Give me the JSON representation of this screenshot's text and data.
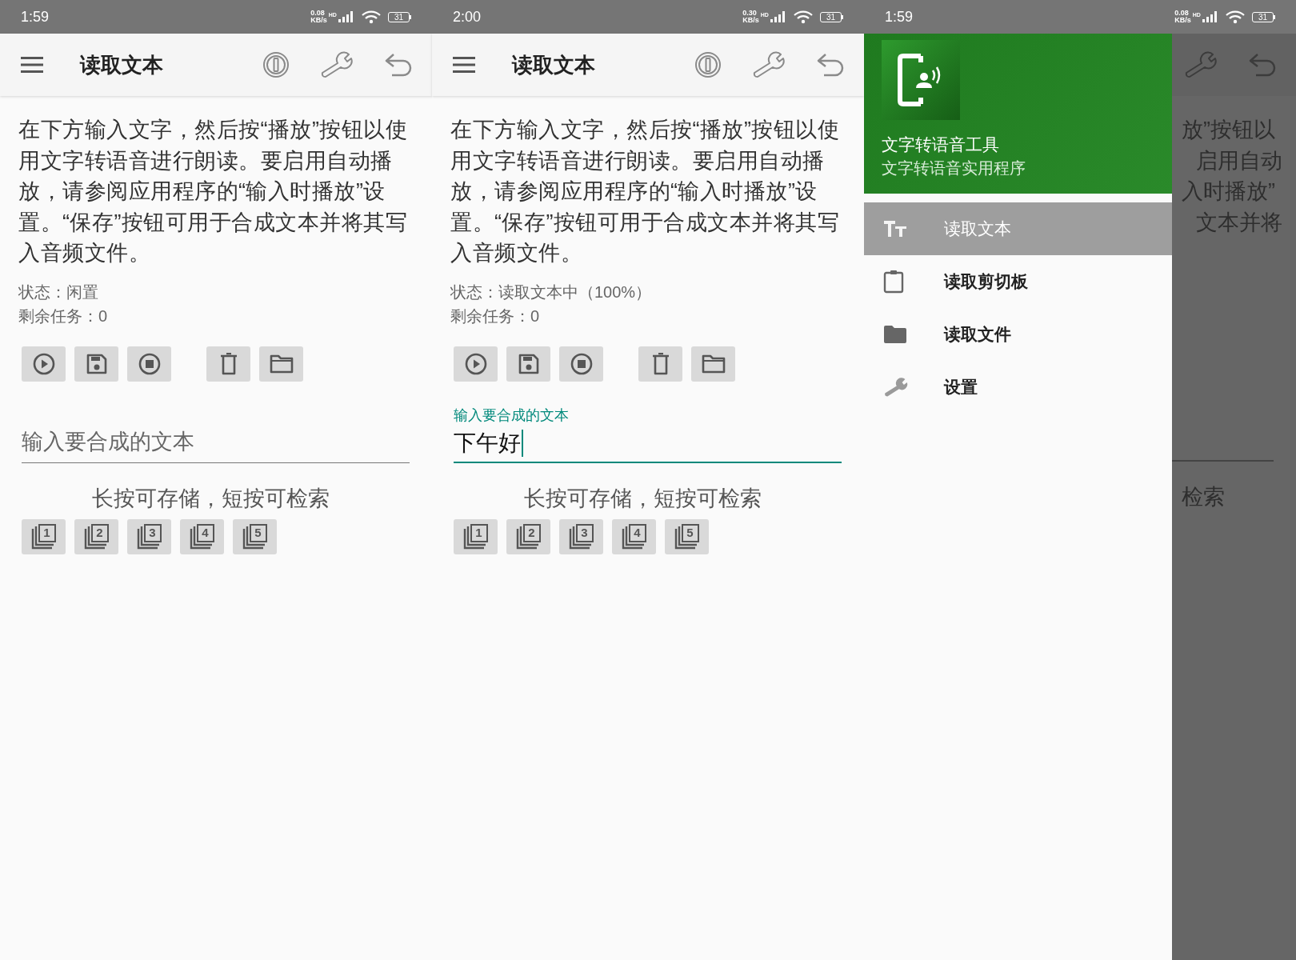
{
  "screens": [
    {
      "status_bar": {
        "time": "1:59",
        "speed": "0.08",
        "speed_unit": "KB/s",
        "network": "HD",
        "battery": "31"
      },
      "toolbar": {
        "title": "读取文本"
      },
      "instructions": "在下方输入文字，然后按“播放”按钮以使用文字转语音进行朗读。要启用自动播放，请参阅应用程序的“输入时播放”设置。“保存”按钮可用于合成文本并将其写入音频文件。",
      "status": "状态：闲置",
      "remaining": "剩余任务：0",
      "input": {
        "focused": false,
        "placeholder": "输入要合成的文本"
      },
      "hint": "长按可存储，短按可检索",
      "slots": [
        "1",
        "2",
        "3",
        "4",
        "5"
      ]
    },
    {
      "status_bar": {
        "time": "2:00",
        "speed": "0.30",
        "speed_unit": "KB/s",
        "network": "HD",
        "battery": "31"
      },
      "toolbar": {
        "title": "读取文本"
      },
      "instructions": "在下方输入文字，然后按“播放”按钮以使用文字转语音进行朗读。要启用自动播放，请参阅应用程序的“输入时播放”设置。“保存”按钮可用于合成文本并将其写入音频文件。",
      "status": "状态：读取文本中（100%）",
      "remaining": "剩余任务：0",
      "input": {
        "focused": true,
        "label": "输入要合成的文本",
        "value": "下午好"
      },
      "hint": "长按可存储，短按可检索",
      "slots": [
        "1",
        "2",
        "3",
        "4",
        "5"
      ]
    },
    {
      "status_bar": {
        "time": "1:59",
        "speed": "0.08",
        "speed_unit": "KB/s",
        "network": "HD",
        "battery": "31"
      },
      "drawer": {
        "title": "文字转语音工具",
        "subtitle": "文字转语音实用程序",
        "items": [
          {
            "label": "读取文本",
            "selected": true
          },
          {
            "label": "读取剪切板",
            "selected": false
          },
          {
            "label": "读取文件",
            "selected": false
          },
          {
            "label": "设置",
            "selected": false
          }
        ]
      },
      "background_lines": [
        "放”按钮以",
        "启用自动",
        "入时播放”",
        "文本并将"
      ],
      "background_hint": "检索"
    }
  ]
}
